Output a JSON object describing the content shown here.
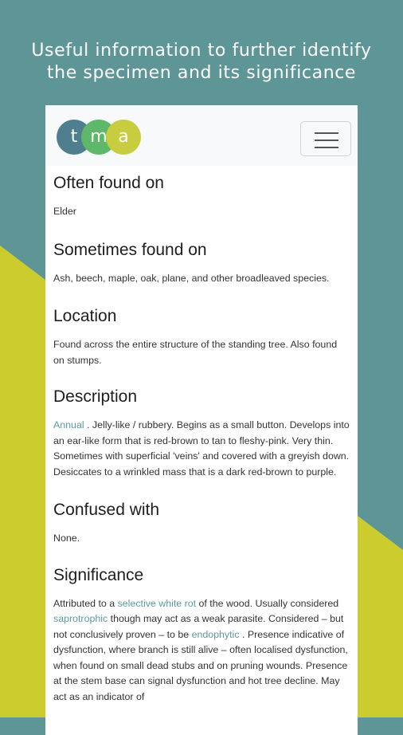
{
  "promo": {
    "line1": "Useful information to further identify",
    "line2": "the specimen and its significance"
  },
  "colors": {
    "background_teal": "#5e9597",
    "background_lime": "#cccc2e",
    "link": "#5d9aa0"
  },
  "header": {
    "logo_letters": [
      "t",
      "m",
      "a"
    ],
    "menu_icon": "hamburger-icon"
  },
  "sections": {
    "often": {
      "title": "Often found on",
      "text": "Elder"
    },
    "sometimes": {
      "title": "Sometimes found on",
      "text": "Ash, beech, maple, oak, plane, and other broadleaved species."
    },
    "location": {
      "title": "Location",
      "text": "Found across the entire structure of the standing tree. Also found on stumps."
    },
    "description": {
      "title": "Description",
      "link": "Annual",
      "text": " . Jelly-like / rubbery. Begins as a small button. Develops into an ear-like form that is red-brown to tan to fleshy-pink. Very thin. Sometimes with superficial 'veins' and covered with a greyish down. Desiccates to a wrinkled mass that is a dark red-brown to purple."
    },
    "confused": {
      "title": "Confused with",
      "text": "None."
    },
    "significance": {
      "title": "Significance",
      "t1": "Attributed to a ",
      "link1": "selective white rot",
      "t2": " of the wood. Usually considered ",
      "link2": "saprotrophic",
      "t3": " though may act as a weak parasite. Considered – but not conclusively proven – to be ",
      "link3": "endophytic",
      "t4": " . Presence indicative of dysfunction, where branch is still alive – often localised dysfunction, when found on small dead stubs and on pruning wounds. Presence at the stem base can signal dysfunction and hot tree decline. May act as an indicator of"
    }
  }
}
